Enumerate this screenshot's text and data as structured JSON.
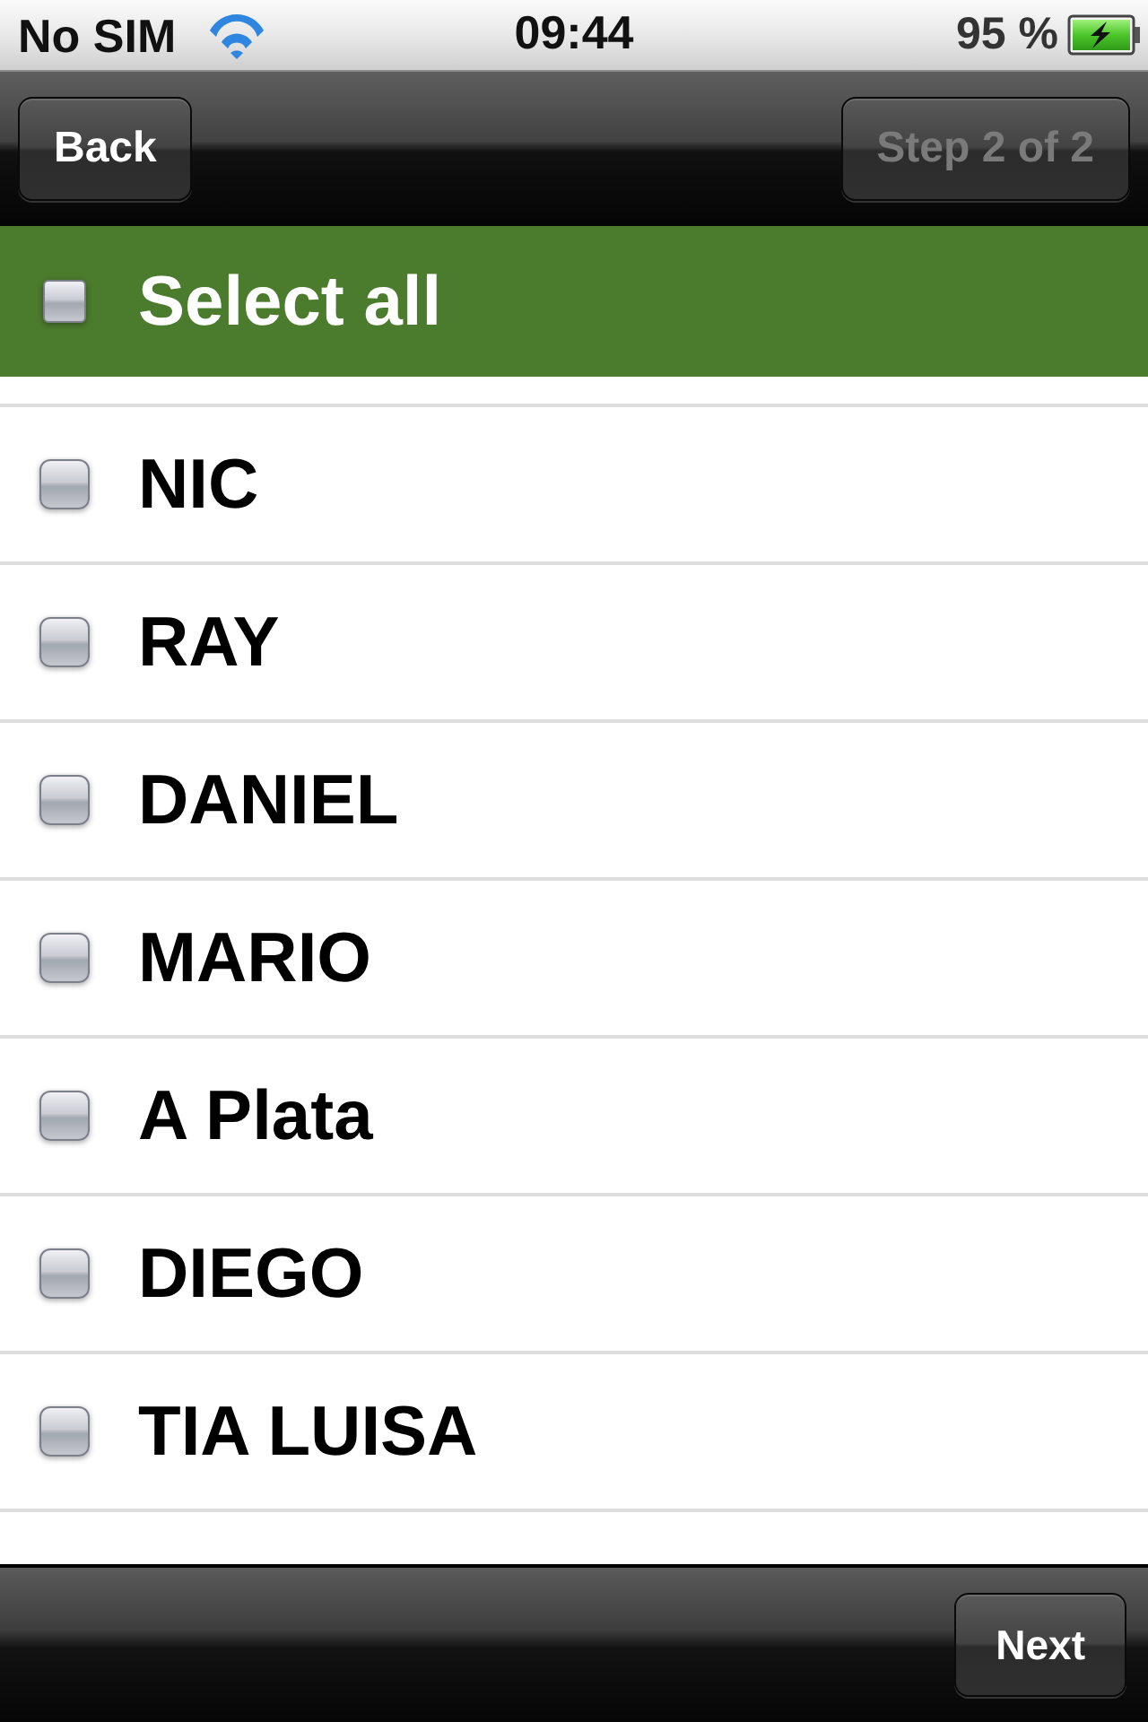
{
  "status_bar": {
    "carrier": "No SIM",
    "time": "09:44",
    "battery": "95 %",
    "charging": true
  },
  "nav_bar": {
    "back_button": {
      "label": "Back",
      "disabled": false
    },
    "step_button": {
      "label": "Step 2 of 2",
      "disabled": true
    }
  },
  "select_all": {
    "label": "Select all",
    "checked": false
  },
  "contacts": [
    {
      "name": "NIC",
      "checked": false
    },
    {
      "name": "RAY",
      "checked": false
    },
    {
      "name": "DANIEL",
      "checked": false
    },
    {
      "name": "MARIO",
      "checked": false
    },
    {
      "name": "A Plata",
      "checked": false
    },
    {
      "name": "DIEGO",
      "checked": false
    },
    {
      "name": "TIA LUISA",
      "checked": false
    }
  ],
  "toolbar": {
    "next_button": {
      "label": "Next",
      "disabled": false
    }
  }
}
